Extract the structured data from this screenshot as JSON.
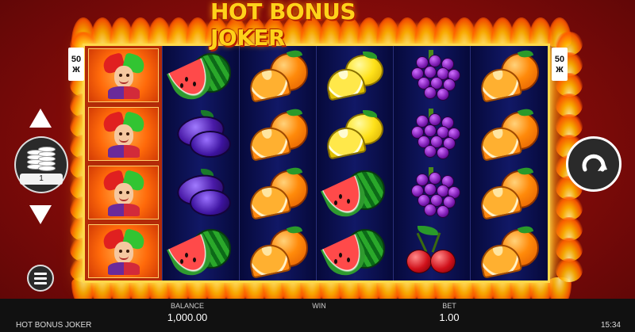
{
  "game": {
    "title": "HOT BONUS JOKER",
    "footer_name": "HOT BONUS JOKER",
    "clock": "15:34"
  },
  "lines": {
    "left": {
      "count": "50",
      "glyph": "ж"
    },
    "right": {
      "count": "50",
      "glyph": "ж"
    }
  },
  "bet_control": {
    "value": "1",
    "up_icon": "triangle-up-icon",
    "down_icon": "triangle-down-icon",
    "coin_icon": "coin-stack-icon"
  },
  "menu": {
    "icon": "hamburger-menu-icon"
  },
  "spin": {
    "icon": "spin-arrow-icon"
  },
  "reels": [
    [
      "joker",
      "joker",
      "joker",
      "joker"
    ],
    [
      "watermelon",
      "plum",
      "plum",
      "watermelon"
    ],
    [
      "orange",
      "orange",
      "orange",
      "orange"
    ],
    [
      "lemon",
      "lemon",
      "watermelon",
      "watermelon"
    ],
    [
      "grapes",
      "grapes",
      "grapes",
      "cherry"
    ],
    [
      "orange",
      "orange",
      "orange",
      "orange"
    ]
  ],
  "status_bar": {
    "balance_label": "BALANCE",
    "balance_value": "1,000.00",
    "win_label": "WIN",
    "win_value": "",
    "bet_label": "BET",
    "bet_value": "1.00"
  },
  "colors": {
    "background": "#a01210",
    "frame": "#ffd84a",
    "reel_bg": "#0a0e3a",
    "logo": "#ffd21a"
  }
}
